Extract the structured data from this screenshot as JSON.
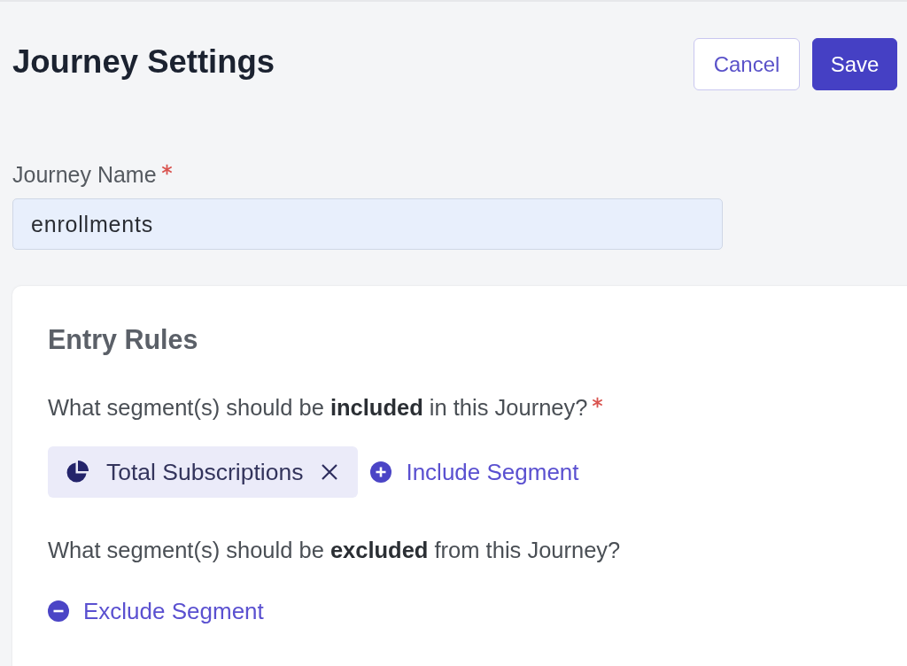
{
  "header": {
    "title": "Journey Settings",
    "buttons": [
      {
        "label": "Cancel",
        "kind": "secondary"
      },
      {
        "label": "Save",
        "kind": "primary"
      }
    ]
  },
  "journey_name": {
    "label": "Journey Name",
    "required": true,
    "value": "enrollments"
  },
  "entry_rules": {
    "title": "Entry Rules",
    "sections": [
      {
        "question": "What segment(s) should be **included** in this Journey?",
        "required": true,
        "segments": [
          {
            "name": "Total Subscriptions"
          }
        ],
        "action": {
          "label": "Include Segment",
          "kind": "add"
        }
      },
      {
        "question": "What segment(s) should be **excluded** from this Journey?",
        "required": false,
        "action": {
          "label": "Exclude Segment",
          "kind": "remove"
        }
      }
    ]
  }
}
